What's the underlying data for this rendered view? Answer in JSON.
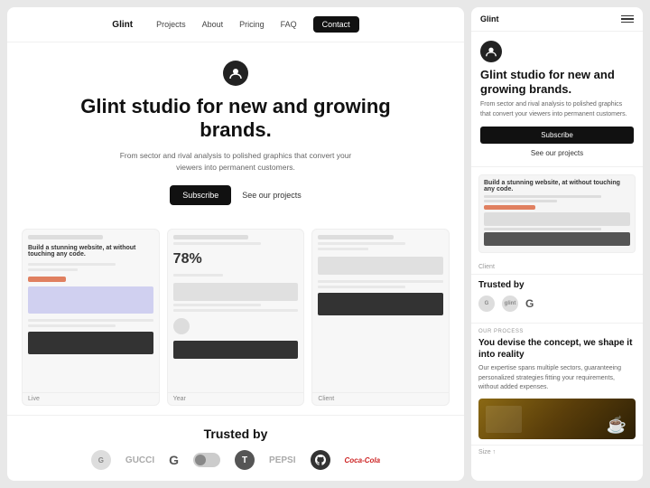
{
  "nav": {
    "logo": "Glint",
    "links": [
      "Projects",
      "About",
      "Pricing",
      "FAQ"
    ],
    "cta": "Contact"
  },
  "hero": {
    "title": "Glint studio for new and growing brands.",
    "subtitle": "From sector and rival analysis to polished graphics that convert your viewers into permanent customers.",
    "btn_subscribe": "Subscribe",
    "btn_projects": "See our projects"
  },
  "screenshots": {
    "left_label": "Live",
    "center_label": "Year",
    "right_label": "Client",
    "card1_title": "Build a stunning website, at without touching any code.",
    "card2_percent": "78%",
    "card3_label": "Client"
  },
  "trusted": {
    "title": "Trusted by",
    "logos": [
      "GUCCI",
      "G",
      "switch",
      "T",
      "PEPSI",
      "github",
      "CocaCola"
    ]
  },
  "mobile": {
    "logo": "Glint",
    "hero_title": "Glint studio for new and growing brands.",
    "hero_subtitle": "From sector and rival analysis to polished graphics that convert your viewers into permanent customers.",
    "btn_subscribe": "Subscribe",
    "btn_projects": "See our projects",
    "client_label": "Client",
    "trusted_title": "Trusted by",
    "process_tag": "OUR PROCESS",
    "process_title": "You devise the concept, we shape it into reality",
    "process_desc": "Our expertise spans multiple sectors, guaranteeing personalized strategies fitting your requirements, without added expenses.",
    "footer_size": "Size ↑"
  }
}
